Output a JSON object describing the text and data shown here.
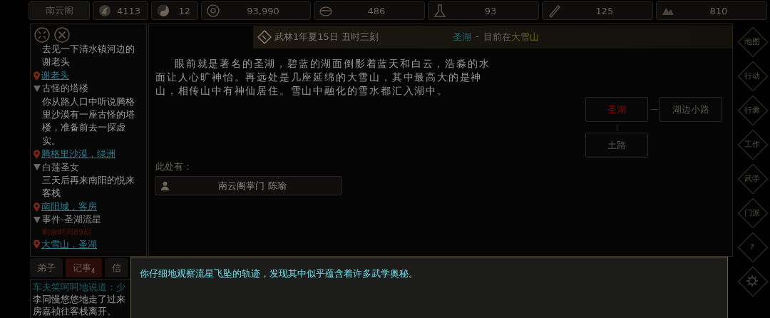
{
  "top_bar": {
    "sect": "南云阁",
    "stats": [
      {
        "value": "4113"
      },
      {
        "value": "12"
      },
      {
        "value": "93,990"
      },
      {
        "value": "486"
      },
      {
        "value": "93"
      },
      {
        "value": "125"
      },
      {
        "value": "810"
      }
    ]
  },
  "quests": [
    {
      "desc": "去见一下清水镇河边的谢老头",
      "location": "谢老头"
    },
    {
      "title": "古怪的塔楼",
      "expanded": true,
      "desc": "你从路人口中听说腾格里沙漠有一座古怪的塔楼，准备前去一探虚实。",
      "location": "腾格里沙漠，绿洲"
    },
    {
      "title": "白莲圣女",
      "expanded": true,
      "desc": "三天后再来南阳的悦来客栈",
      "location": "南阳城，客房"
    },
    {
      "title": "事件-圣湖流星",
      "expanded": true,
      "timer": "剩余时间89刻",
      "location": "大雪山，圣湖"
    }
  ],
  "bottom_tabs": [
    {
      "label": "弟子",
      "selected": false
    },
    {
      "label": "记事",
      "badge": "4",
      "selected": true
    },
    {
      "label": "信",
      "selected": false
    }
  ],
  "log": [
    {
      "kind": "speech",
      "text": "车夫笑呵呵地说道：少"
    },
    {
      "kind": "plain",
      "text": "李同慢悠悠地走了过来"
    },
    {
      "kind": "plain",
      "text": "房嘉祯往客栈离开。"
    }
  ],
  "header": {
    "date": "武林1年夏15日 丑时三刻",
    "place": "圣湖",
    "separator": "-",
    "prefix": "目前在",
    "region": "大雪山"
  },
  "description": "眼前就是著名的圣湖，碧蓝的湖面倒影着蓝天和白云，浩淼的水面让人心旷神怡。再远处是几座延绵的大雪山，其中最高大的是神山，相传山中有神仙居住。雪山中融化的雪水都汇入湖中。",
  "here_label": "此处有：",
  "people": [
    {
      "name": "南云阁掌门 陈瑜"
    }
  ],
  "map": {
    "nodes": [
      {
        "label": "圣湖",
        "current": true
      },
      {
        "label": "湖边小路",
        "current": false
      },
      {
        "label": "土路",
        "current": false
      }
    ]
  },
  "side_menu": [
    {
      "kind": "text",
      "label": "地图"
    },
    {
      "kind": "text",
      "label": "行动"
    },
    {
      "kind": "text",
      "label": "行囊"
    },
    {
      "kind": "text",
      "label": "工作"
    },
    {
      "kind": "text",
      "label": "武学"
    },
    {
      "kind": "text",
      "label": "门派"
    },
    {
      "kind": "text",
      "label": "?"
    },
    {
      "kind": "gear"
    }
  ],
  "dialog": {
    "text": "你仔细地观察流星飞坠的轨迹，发现其中似乎蕴含着许多武学奥秘。"
  }
}
